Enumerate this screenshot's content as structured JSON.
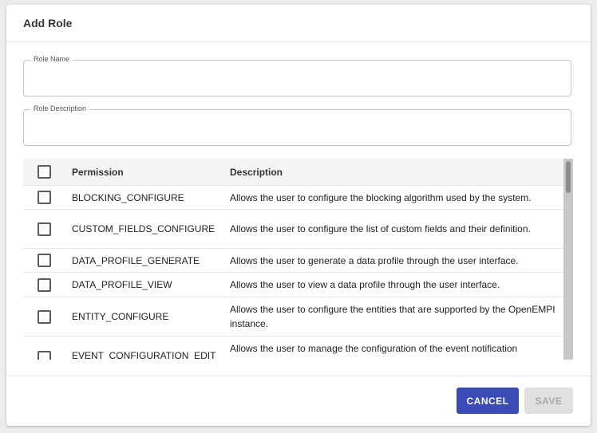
{
  "dialog": {
    "title": "Add Role",
    "role_name": {
      "label": "Role Name",
      "value": "",
      "placeholder": ""
    },
    "role_description": {
      "label": "Role Description",
      "value": "",
      "placeholder": ""
    }
  },
  "table": {
    "headers": {
      "permission": "Permission",
      "description": "Description"
    },
    "rows": [
      {
        "permission": "BLOCKING_CONFIGURE",
        "description": "Allows the user to configure the blocking algorithm used by the system."
      },
      {
        "permission": "CUSTOM_FIELDS_CONFIGURE",
        "description": "Allows the user to configure the list of custom fields and their definition."
      },
      {
        "permission": "DATA_PROFILE_GENERATE",
        "description": "Allows the user to generate a data profile through the user interface."
      },
      {
        "permission": "DATA_PROFILE_VIEW",
        "description": "Allows the user to view a data profile through the user interface."
      },
      {
        "permission": "ENTITY_CONFIGURE",
        "description": "Allows the user to configure the entities that are supported by the OpenEMPI instance."
      },
      {
        "permission": "EVENT_CONFIGURATION_EDIT",
        "description": "Allows the user to manage the configuration of the event notification"
      }
    ]
  },
  "footer": {
    "cancel_label": "CANCEL",
    "save_label": "SAVE"
  },
  "colors": {
    "primary": "#3a4bb5",
    "disabled_bg": "#e0e0e0",
    "disabled_text": "#a9a9a9"
  }
}
